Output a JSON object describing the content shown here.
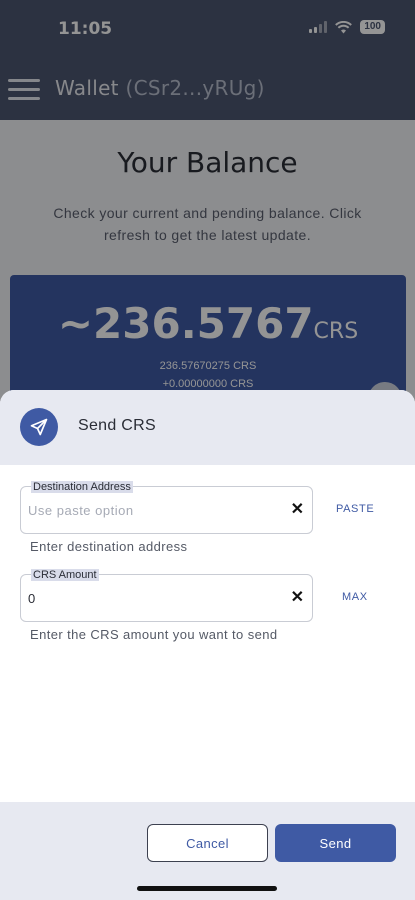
{
  "status_bar": {
    "time": "11:05",
    "battery": "100",
    "icons": [
      "signal-icon",
      "wifi-icon",
      "battery-icon"
    ]
  },
  "app_bar": {
    "title": "Wallet",
    "address": "(CSr2...yRUg)",
    "menu_icon": "hamburger-menu-icon"
  },
  "balance": {
    "title": "Your Balance",
    "description": "Check your current and pending balance. Click refresh to get the latest update.",
    "main_amount": "~236.5767",
    "unit": "CRS",
    "confirmed": "236.57670275 CRS",
    "pending": "+0.00000000 CRS"
  },
  "sheet": {
    "icon": "send-icon",
    "title": "Send CRS",
    "destination": {
      "label": "Destination Address",
      "value": "",
      "placeholder": "Use paste option",
      "helper": "Enter destination address",
      "action": "PASTE"
    },
    "amount": {
      "label": "CRS Amount",
      "value": "0",
      "placeholder": "",
      "helper": "Enter the CRS amount you want to send",
      "action": "MAX"
    },
    "cancel_label": "Cancel",
    "send_label": "Send"
  },
  "colors": {
    "primary": "#3f5aa4",
    "appbar": "#4d5670",
    "sheet_header": "#e7e9f1"
  }
}
